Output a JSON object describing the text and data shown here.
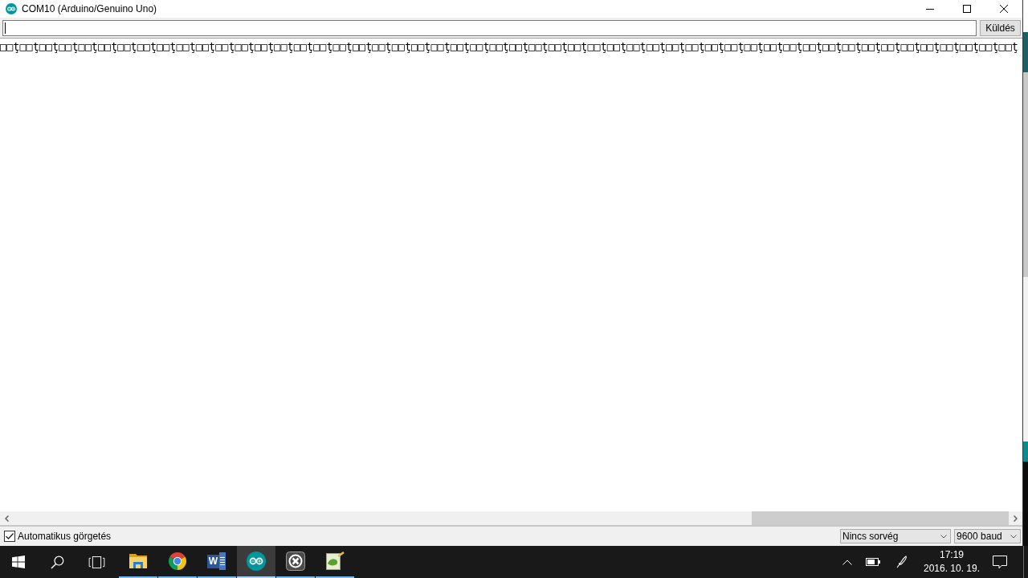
{
  "window": {
    "title": "COM10 (Arduino/Genuino Uno)"
  },
  "send_button": {
    "label": "Küldés"
  },
  "output_lines": [
    "□□ţ□□ţ□□ţ□□ţ□□ţ□□ţ□□ţ□□ţ□□ţ□□ţ□□ţ□□ţ□□ţ□□ţ□□ţ□□ţ□□ţ□□ţ□□ţ□□ţ□□ţ□□ţ□□ţ□□ţ□□ţ□□ţ□□ţ□□ţ□□ţ□□ţ□□ţ□□ţ□□ţ□□ţ□□ţ□□ţ□□ţ□□ţ□□ţ□□ţ□□ţ□□ţ□□ţ□□ţ□□ţ□□ţ□□ţ□□ţ□□ţ□□ţ□□ţ□□ţ"
  ],
  "autoscroll": {
    "label": "Automatikus görgetés",
    "checked": true
  },
  "line_ending": {
    "value": "Nincs sorvég"
  },
  "baud_rate": {
    "value": "9600 baud"
  },
  "taskbar": {
    "buttons": [
      {
        "kind": "start"
      },
      {
        "kind": "search"
      },
      {
        "kind": "task-view"
      }
    ],
    "apps": [
      {
        "kind": "folder",
        "running": true,
        "selected": false
      },
      {
        "kind": "browser",
        "running": true,
        "selected": false
      },
      {
        "kind": "document",
        "glyph": "W",
        "running": true,
        "selected": false
      },
      {
        "kind": "arduino",
        "running": true,
        "selected": true
      },
      {
        "kind": "circle-cross",
        "running": true,
        "selected": false
      },
      {
        "kind": "notepad",
        "running": true,
        "selected": false
      }
    ],
    "tray": [
      {
        "kind": "chevron"
      },
      {
        "kind": "battery"
      },
      {
        "kind": "pen"
      }
    ],
    "clock": {
      "time": "17:19",
      "date": "2016. 10. 19."
    }
  }
}
